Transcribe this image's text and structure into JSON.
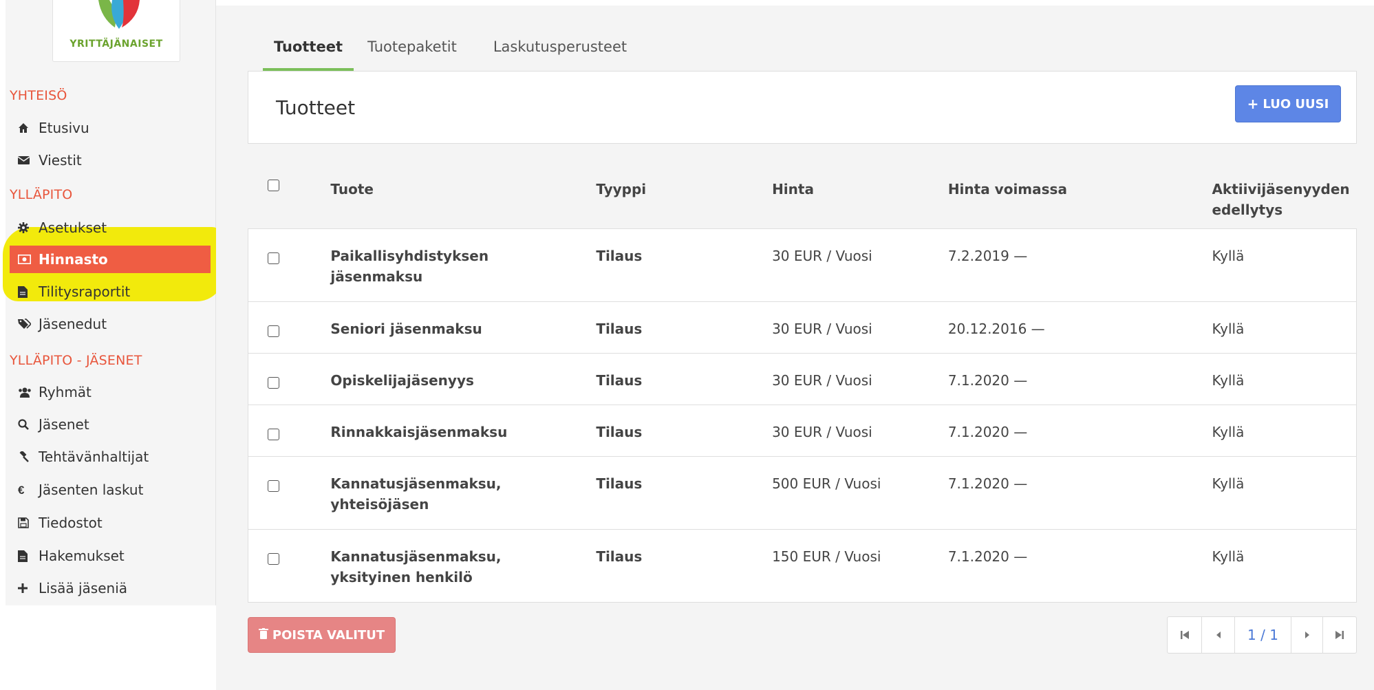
{
  "colors": {
    "accent": "#ef5d43",
    "section": "#e8553b",
    "tab_active": "#7bbf5a",
    "primary_button": "#5d86e6",
    "danger_button": "#e68585",
    "highlight": "#f2ea0c"
  },
  "logo": {
    "text": "YRITTÄJÄNAISET"
  },
  "sidebar": {
    "sections": [
      {
        "title": "YHTEISÖ",
        "items": [
          {
            "label": "Etusivu",
            "icon": "home-icon"
          },
          {
            "label": "Viestit",
            "icon": "envelope-icon"
          }
        ]
      },
      {
        "title": "YLLÄPITO",
        "items": [
          {
            "label": "Asetukset",
            "icon": "gear-icon"
          },
          {
            "label": "Hinnasto",
            "icon": "money-icon",
            "active": true
          },
          {
            "label": "Tilitysraportit",
            "icon": "file-icon"
          },
          {
            "label": "Jäsenedut",
            "icon": "tags-icon"
          }
        ]
      },
      {
        "title": "YLLÄPITO - JÄSENET",
        "items": [
          {
            "label": "Ryhmät",
            "icon": "users-icon"
          },
          {
            "label": "Jäsenet",
            "icon": "search-icon"
          },
          {
            "label": "Tehtävänhaltijat",
            "icon": "gavel-icon"
          },
          {
            "label": "Jäsenten laskut",
            "icon": "euro-icon"
          },
          {
            "label": "Tiedostot",
            "icon": "save-icon"
          },
          {
            "label": "Hakemukset",
            "icon": "file-icon"
          },
          {
            "label": "Lisää jäseniä",
            "icon": "plus-icon"
          }
        ]
      }
    ]
  },
  "tabs": [
    "Tuotteet",
    "Tuotepaketit",
    "Laskutusperusteet"
  ],
  "active_tab": "Tuotteet",
  "header": {
    "title": "Tuotteet",
    "create_button": "LUO UUSI"
  },
  "table": {
    "columns": [
      "Tuote",
      "Tyyppi",
      "Hinta",
      "Hinta voimassa",
      "Aktiivijäsenyyden edellytys"
    ],
    "rows": [
      {
        "name": "Paikallisyhdistyksen jäsenmaksu",
        "type": "Tilaus",
        "price": "30 EUR / Vuosi",
        "valid": "7.2.2019 —",
        "required": "Kyllä"
      },
      {
        "name": "Seniori jäsenmaksu",
        "type": "Tilaus",
        "price": "30 EUR / Vuosi",
        "valid": "20.12.2016 —",
        "required": "Kyllä"
      },
      {
        "name": "Opiskelijajäsenyys",
        "type": "Tilaus",
        "price": "30 EUR / Vuosi",
        "valid": "7.1.2020 —",
        "required": "Kyllä"
      },
      {
        "name": "Rinnakkaisjäsenmaksu",
        "type": "Tilaus",
        "price": "30 EUR / Vuosi",
        "valid": "7.1.2020 —",
        "required": "Kyllä"
      },
      {
        "name": "Kannatusjäsenmaksu, yhteisöjäsen",
        "type": "Tilaus",
        "price": "500 EUR / Vuosi",
        "valid": "7.1.2020 —",
        "required": "Kyllä"
      },
      {
        "name": "Kannatusjäsenmaksu, yksityinen henkilö",
        "type": "Tilaus",
        "price": "150 EUR / Vuosi",
        "valid": "7.1.2020 —",
        "required": "Kyllä"
      }
    ]
  },
  "delete_button": "POISTA VALITUT",
  "pagination": {
    "label": "1 / 1"
  }
}
